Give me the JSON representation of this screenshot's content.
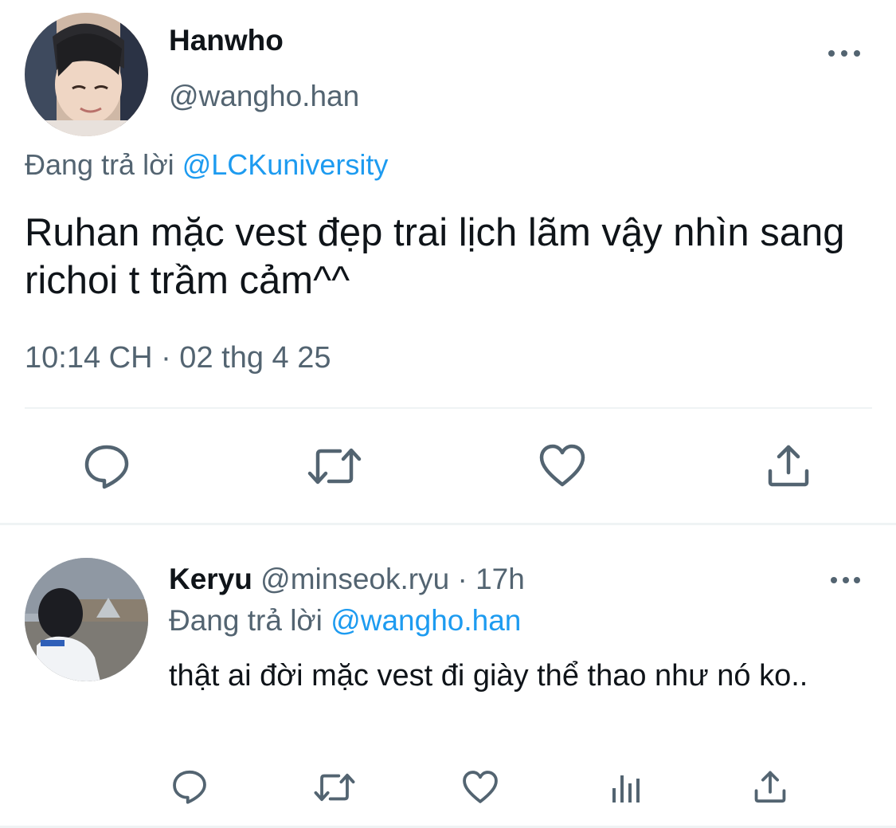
{
  "main_tweet": {
    "display_name": "Hanwho",
    "handle": "@wangho.han",
    "replying_prefix": "Đang trả lời",
    "replying_to": "@LCKuniversity",
    "text": "Ruhan mặc vest đẹp trai lịch lãm vậy nhìn sang richoi t trầm cảm^^",
    "timestamp": "10:14 CH · 02 thg 4 25",
    "actions": [
      "reply-icon",
      "retweet-icon",
      "like-icon",
      "share-icon"
    ]
  },
  "reply_tweet": {
    "display_name": "Keryu",
    "handle_time": "@minseok.ryu · 17h",
    "replying_prefix": "Đang trả lời",
    "replying_to": "@wangho.han",
    "text": "thật ai đời mặc vest đi giày thể thao như nó ko..",
    "actions": [
      "reply-icon",
      "retweet-icon",
      "like-icon",
      "analytics-icon",
      "share-icon"
    ]
  },
  "colors": {
    "text_primary": "#0f1419",
    "text_secondary": "#536471",
    "link": "#1d9bf0",
    "divider": "#eff3f4"
  }
}
